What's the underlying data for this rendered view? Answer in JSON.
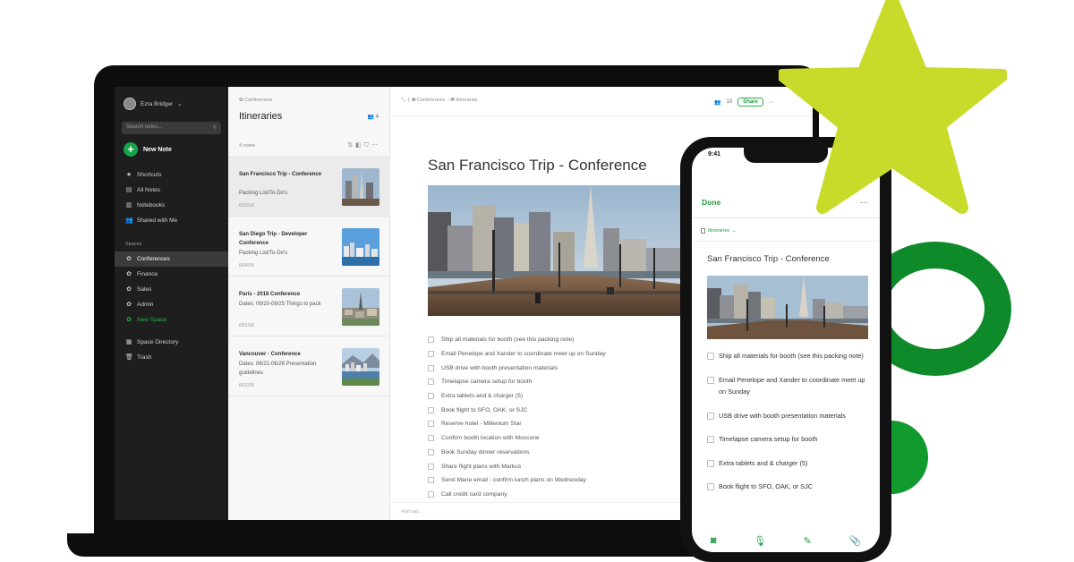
{
  "colors": {
    "accent": "#1f9c3f",
    "sidebar_bg": "#1e1e1e",
    "star": "#c8db2a",
    "ring": "#0e8a2a"
  },
  "sidebar": {
    "user_name": "Ezra Bridger",
    "search_placeholder": "Search notes...",
    "new_note_label": "New Note",
    "items": [
      {
        "label": "Shortcuts",
        "icon": "star-icon"
      },
      {
        "label": "All Notes",
        "icon": "note-icon"
      },
      {
        "label": "Notebooks",
        "icon": "notebook-icon"
      },
      {
        "label": "Shared with Me",
        "icon": "people-icon"
      }
    ],
    "spaces_heading": "Spaces",
    "spaces": [
      {
        "label": "Conferences",
        "icon": "space-icon",
        "active": true
      },
      {
        "label": "Finance",
        "icon": "space-icon"
      },
      {
        "label": "Sales",
        "icon": "space-icon"
      },
      {
        "label": "Admin",
        "icon": "space-icon"
      },
      {
        "label": "New Space",
        "icon": "new-space-icon"
      }
    ],
    "bottom_items": [
      {
        "label": "Space Directory",
        "icon": "directory-icon"
      },
      {
        "label": "Trash",
        "icon": "trash-icon"
      }
    ]
  },
  "notelist": {
    "breadcrumb": "Conferences",
    "title": "Itineraries",
    "members": "4",
    "count_label": "4 notes",
    "notes": [
      {
        "title": "San Francisco Trip - Conference",
        "snippet": "Packing List/To-Do's",
        "date": "6/20/18"
      },
      {
        "title": "San Diego Trip - Developer Conference",
        "snippet": "Packing List/To-Do's",
        "date": "6/04/18"
      },
      {
        "title": "Paris - 2018 Conference",
        "snippet": "Dates: 09/20-09/25 Things to pack",
        "date": "6/01/18"
      },
      {
        "title": "Vancouver - Conference",
        "snippet": "Dates: 06/21-06/26 Presentation guidelines",
        "date": "6/01/18"
      }
    ]
  },
  "editor": {
    "crumb_space": "Conferences",
    "crumb_notebook": "Itineraries",
    "members": "10",
    "share_label": "Share",
    "title": "San Francisco Trip - Conference",
    "checklist": [
      "Ship all materials for booth (see this packing note)",
      "Email Penelope and Xander to coordinate meet up on Sunday",
      "USB drive with booth presentation materials",
      "Timelapse camera setup for booth",
      "Extra tablets and & charger (5)",
      "Book flight to SFO, OAK, or SJC",
      "Reserve hotel - Millenium Star",
      "Confirm booth location with Moscone",
      "Book Sunday dinner reservations",
      "Share flight plans with Markus",
      "Send Marie email - confirm lunch plans on Wednesday",
      "Call credit card company"
    ],
    "tags_placeholder": "Add tag..."
  },
  "phone": {
    "time": "9:41",
    "done_label": "Done",
    "notebook": "Itineraries",
    "title": "San Francisco Trip - Conference",
    "checklist": [
      "Ship all materials for booth (see this packing note)",
      "Email Penelope and Xander to coordinate meet up on Sunday",
      "USB drive with booth presentation materials",
      "Timelapse camera setup for booth",
      "Extra tablets and & charger (5)",
      "Book flight to SFO, OAK, or SJC"
    ],
    "toolbar": [
      "camera-icon",
      "microphone-icon",
      "sketch-icon",
      "attachment-icon"
    ]
  }
}
